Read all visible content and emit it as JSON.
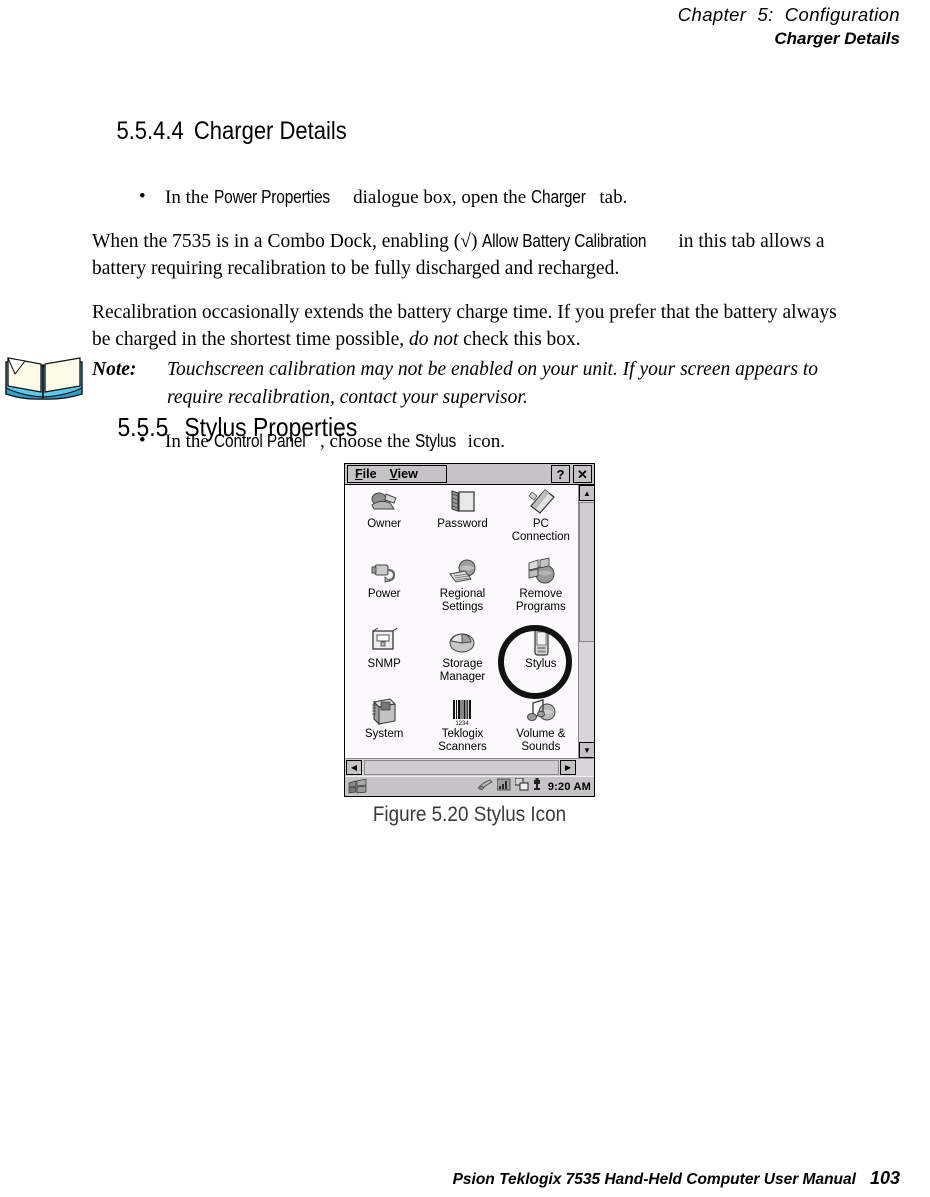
{
  "header": {
    "chapter": "Chapter  5:  Configuration",
    "section": "Charger Details"
  },
  "sections": {
    "h4_number": "5.5.4.4",
    "h4_title": "Charger Details",
    "bullet1_pre": "In the ",
    "bullet1_ui1": "Power Properties",
    "bullet1_mid": " dialogue box, open the ",
    "bullet1_ui2": "Charger",
    "bullet1_post": " tab.",
    "para1_pre": "When the 7535 is in a Combo Dock, enabling (√) ",
    "para1_ui": "Allow Battery Calibration",
    "para1_post": " in this tab allows a battery requiring recalibration to be fully discharged and recharged.",
    "para2_pre": "Recalibration occasionally extends the battery charge time. If you prefer that the battery always be charged in the shortest time possible, ",
    "para2_ital": "do not",
    "para2_post": " check this box.",
    "h3_number": "5.5.5",
    "h3_title": "Stylus Properties"
  },
  "note": {
    "label": "Note:",
    "text": "Touchscreen calibration may not be enabled on your unit. If your screen appears to require recalibration, contact your supervisor.",
    "icon": "open-book-icon"
  },
  "bullet2": {
    "pre": "In the ",
    "ui1": "Control Panel",
    "mid": ", choose the ",
    "ui2": "Stylus",
    "post": " icon."
  },
  "ce_window": {
    "menu": {
      "file": "File",
      "file_accel": "F",
      "view": "View",
      "view_accel": "V"
    },
    "buttons": {
      "help": "?",
      "close": "✕"
    },
    "icons": [
      {
        "label": "Owner",
        "icon": "owner-icon",
        "highlighted": false
      },
      {
        "label": "Password",
        "icon": "password-icon",
        "highlighted": false
      },
      {
        "label": "PC\nConnection",
        "icon": "pc-connection-icon",
        "highlighted": false
      },
      {
        "label": "Power",
        "icon": "power-icon",
        "highlighted": false
      },
      {
        "label": "Regional\nSettings",
        "icon": "regional-settings-icon",
        "highlighted": false
      },
      {
        "label": "Remove\nPrograms",
        "icon": "remove-programs-icon",
        "highlighted": false
      },
      {
        "label": "SNMP",
        "icon": "snmp-icon",
        "highlighted": false
      },
      {
        "label": "Storage\nManager",
        "icon": "storage-manager-icon",
        "highlighted": false
      },
      {
        "label": "Stylus",
        "icon": "stylus-icon",
        "highlighted": true
      },
      {
        "label": "System",
        "icon": "system-icon",
        "highlighted": false
      },
      {
        "label": "Teklogix\nScanners",
        "icon": "teklogix-scanners-icon",
        "highlighted": false
      },
      {
        "label": "Volume &\nSounds",
        "icon": "volume-sounds-icon",
        "highlighted": false
      }
    ],
    "taskbar": {
      "start": "start-button-icon",
      "tray": [
        "stylus-tray-icon",
        "signal-tray-icon",
        "network-tray-icon",
        "battery-tray-icon"
      ],
      "clock": "9:20 AM"
    },
    "scrollbars": {
      "up_arrow": "▲",
      "down_arrow": "▼",
      "left_arrow": "◀",
      "right_arrow": "▶"
    }
  },
  "figure": {
    "caption": "Figure 5.20 Stylus Icon"
  },
  "footer": {
    "manual": "Psion Teklogix 7535 Hand-Held Computer User Manual",
    "page": "103"
  },
  "colors": {
    "ce_face": "#c6c3c6",
    "ce_client": "#fbf9fb",
    "ring": "#111111",
    "caption": "#3a3a3a"
  }
}
